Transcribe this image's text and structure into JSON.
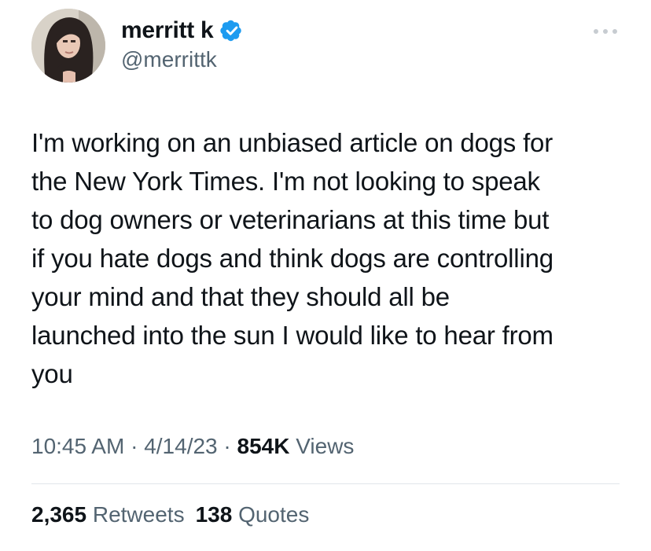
{
  "author": {
    "display_name": "merritt k",
    "handle": "@merrittk",
    "verified": true,
    "badge_color": "#1d9bf0"
  },
  "tweet": {
    "text": "I'm working on an unbiased article on dogs for\nthe New York Times. I'm not looking to speak\nto dog owners or veterinarians at this time but\nif you hate dogs and think dogs are controlling\nyour mind and that they should all be\nlaunched into the sun I would like to hear from\nyou"
  },
  "meta": {
    "time": "10:45 AM",
    "separator_1": " · ",
    "date": "4/14/23",
    "separator_2": " · ",
    "views_count": "854K",
    "views_label": " Views"
  },
  "stats": {
    "retweets_count": "2,365",
    "retweets_label": " Retweets",
    "quotes_count": "138",
    "quotes_label": " Quotes"
  },
  "icons": {
    "more": "more-horizontal-icon",
    "badge": "verified-badge-icon"
  },
  "colors": {
    "text_primary": "#0f1419",
    "text_secondary": "#536471",
    "divider": "#e1e6ea",
    "more_icon": "#c7ccd1"
  }
}
